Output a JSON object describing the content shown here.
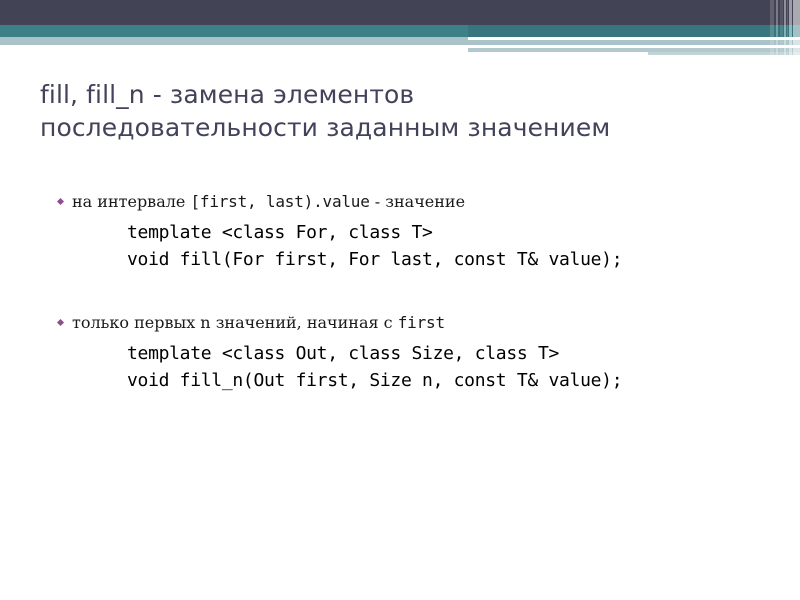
{
  "header": {
    "bands": [
      {
        "name": "dark-band",
        "color": "#434356"
      },
      {
        "name": "teal-band",
        "color": "#3d8188"
      },
      {
        "name": "pale-band",
        "color": "#a9c3c8"
      }
    ],
    "accent_color": "#37767e",
    "stripe_color": "#a9c3c8"
  },
  "title": {
    "line1": "fill, fill_n - замена элементов",
    "line2": "последовательности заданным значением",
    "color": "#42425a"
  },
  "body": {
    "bullet_color": "#8e4f8e",
    "groups": [
      {
        "bullet": {
          "prefix": "на интервале ",
          "mono": "[first, last).value",
          "suffix": " - значение"
        },
        "code": [
          "template <class For, class T>",
          "void fill(For first, For last, const T& value);"
        ]
      },
      {
        "bullet": {
          "prefix": "только первых n значений, начиная с ",
          "mono": "first",
          "suffix": ""
        },
        "code": [
          "template <class Out, class Size, class T>",
          "void fill_n(Out first, Size n, const T& value);"
        ]
      }
    ]
  }
}
